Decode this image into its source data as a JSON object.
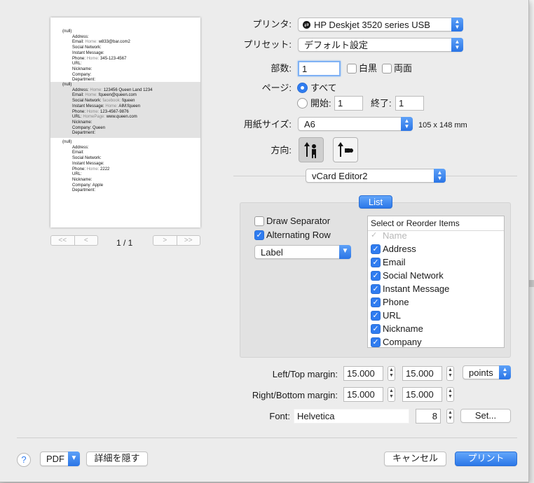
{
  "preview": {
    "records": [
      {
        "alternate": false,
        "lines": [
          {
            "label": "(null)",
            "home": "",
            "value": "",
            "indent": false
          },
          {
            "label": "Address:",
            "home": "",
            "value": "",
            "indent": true
          },
          {
            "label": "Email:",
            "home": "Home:",
            "value": "w833@bar.com2",
            "indent": true
          },
          {
            "label": "Social Network:",
            "home": "",
            "value": "",
            "indent": true
          },
          {
            "label": "Instant Message:",
            "home": "",
            "value": "",
            "indent": true
          },
          {
            "label": "Phone:",
            "home": "Home:",
            "value": "345-123-4567",
            "indent": true
          },
          {
            "label": "URL:",
            "home": "",
            "value": "",
            "indent": true
          },
          {
            "label": "Nickname:",
            "home": "",
            "value": "",
            "indent": true
          },
          {
            "label": "Company:",
            "home": "",
            "value": "",
            "indent": true
          },
          {
            "label": "Department:",
            "home": "",
            "value": "",
            "indent": true
          }
        ]
      },
      {
        "alternate": true,
        "lines": [
          {
            "label": "(null)",
            "home": "",
            "value": "",
            "indent": false
          },
          {
            "label": "Address:",
            "home": "Home:",
            "value": "123456 Queen Land 1234",
            "indent": true
          },
          {
            "label": "Email:",
            "home": "Home:",
            "value": "fqueen@queen.com",
            "indent": true
          },
          {
            "label": "Social Network:",
            "home": "facebook:",
            "value": "fqueen",
            "indent": true
          },
          {
            "label": "Instant Message:",
            "home": "Home:",
            "value": "AIM:fqueen",
            "indent": true
          },
          {
            "label": "Phone:",
            "home": "Home:",
            "value": "123-4567-9876",
            "indent": true
          },
          {
            "label": "URL:",
            "home": "HomePage:",
            "value": "www.queen.com",
            "indent": true
          },
          {
            "label": "Nickname:",
            "home": "",
            "value": "",
            "indent": true
          },
          {
            "label": "Company:",
            "home": "",
            "value": "Queen",
            "indent": true
          },
          {
            "label": "Department:",
            "home": "",
            "value": "",
            "indent": true
          }
        ]
      },
      {
        "alternate": false,
        "lines": [
          {
            "label": "(null)",
            "home": "",
            "value": "",
            "indent": false
          },
          {
            "label": "Address:",
            "home": "",
            "value": "",
            "indent": true
          },
          {
            "label": "Email:",
            "home": "",
            "value": "",
            "indent": true
          },
          {
            "label": "Social Network:",
            "home": "",
            "value": "",
            "indent": true
          },
          {
            "label": "Instant Message:",
            "home": "",
            "value": "",
            "indent": true
          },
          {
            "label": "Phone:",
            "home": "Home:",
            "value": "2222",
            "indent": true
          },
          {
            "label": "URL:",
            "home": "",
            "value": "",
            "indent": true
          },
          {
            "label": "Nickname:",
            "home": "",
            "value": "",
            "indent": true
          },
          {
            "label": "Company:",
            "home": "",
            "value": "Apple",
            "indent": true
          },
          {
            "label": "Department:",
            "home": "",
            "value": "",
            "indent": true
          }
        ]
      }
    ],
    "page_indicator": "1 / 1",
    "nav_first": "<<",
    "nav_prev": "<",
    "nav_next": ">",
    "nav_last": ">>"
  },
  "printer": {
    "label": "プリンタ:",
    "value": "HP Deskjet 3520 series USB"
  },
  "preset": {
    "label": "プリセット:",
    "value": "デフォルト設定"
  },
  "copies": {
    "label": "部数:",
    "value": "1",
    "bw_label": "白黒",
    "duplex_label": "両面"
  },
  "pages": {
    "label": "ページ:",
    "all_label": "すべて",
    "from_label": "開始:",
    "from_value": "1",
    "to_label": "終了:",
    "to_value": "1"
  },
  "paper": {
    "label": "用紙サイズ:",
    "value": "A6",
    "dimensions": "105 x 148 mm"
  },
  "orientation": {
    "label": "方向:"
  },
  "plugin": {
    "value": "vCard Editor2"
  },
  "list_panel": {
    "tab_label": "List",
    "draw_separator": {
      "label": "Draw Separator",
      "checked": false
    },
    "alternating_row": {
      "label": "Alternating Row",
      "checked": true
    },
    "label_popup": "Label",
    "items_header": "Select or Reorder Items",
    "items": [
      {
        "label": "Name",
        "checked": true,
        "disabled": true
      },
      {
        "label": "Address",
        "checked": true
      },
      {
        "label": "Email",
        "checked": true
      },
      {
        "label": "Social Network",
        "checked": true
      },
      {
        "label": "Instant Message",
        "checked": true
      },
      {
        "label": "Phone",
        "checked": true
      },
      {
        "label": "URL",
        "checked": true
      },
      {
        "label": "Nickname",
        "checked": true
      },
      {
        "label": "Company",
        "checked": true
      }
    ]
  },
  "margins": {
    "left_top_label": "Left/Top margin:",
    "left_value": "15.000",
    "top_value": "15.000",
    "units": "points",
    "right_bottom_label": "Right/Bottom margin:",
    "right_value": "15.000",
    "bottom_value": "15.000"
  },
  "font": {
    "label": "Font:",
    "name": "Helvetica",
    "size": "8",
    "set_label": "Set..."
  },
  "bottom": {
    "help": "?",
    "pdf_label": "PDF",
    "hide_details_label": "詳細を隠す",
    "cancel_label": "キャンセル",
    "print_label": "プリント"
  },
  "colors": {
    "accent": "#2f7cf0"
  }
}
